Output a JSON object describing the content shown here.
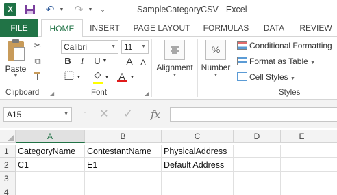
{
  "window": {
    "title": "SampleCategoryCSV - Excel",
    "app_logo_letter": "X"
  },
  "tabs": [
    {
      "label": "FILE"
    },
    {
      "label": "HOME"
    },
    {
      "label": "INSERT"
    },
    {
      "label": "PAGE LAYOUT"
    },
    {
      "label": "FORMULAS"
    },
    {
      "label": "DATA"
    },
    {
      "label": "REVIEW"
    }
  ],
  "active_tab": "HOME",
  "colors": {
    "excel_green": "#217346",
    "font_color_bar": "#e01b1b",
    "highlight_bar": "#ffff00"
  },
  "ribbon": {
    "clipboard": {
      "paste_label": "Paste",
      "group_label": "Clipboard"
    },
    "font": {
      "font_name": "Calibri",
      "font_size": "11",
      "bold": "B",
      "italic": "I",
      "underline": "U",
      "grow": "A",
      "shrink": "A",
      "font_color": "A",
      "group_label": "Font"
    },
    "alignment": {
      "label": "Alignment"
    },
    "number": {
      "label": "Number",
      "icon_text": "%"
    },
    "styles": {
      "conditional_formatting": "Conditional Formatting",
      "format_as_table": "Format as Table",
      "cell_styles": "Cell Styles",
      "group_label": "Styles"
    }
  },
  "formula_bar": {
    "name_box": "A15",
    "fx": "fx",
    "formula": ""
  },
  "sheet": {
    "columns": [
      "A",
      "B",
      "C",
      "D",
      "E"
    ],
    "selected_column": "A",
    "rows": [
      {
        "num": "1",
        "cells": [
          "CategoryName",
          "ContestantName",
          "PhysicalAddress",
          "",
          ""
        ]
      },
      {
        "num": "2",
        "cells": [
          "C1",
          "E1",
          "Default Address",
          "",
          ""
        ]
      },
      {
        "num": "3",
        "cells": [
          "",
          "",
          "",
          "",
          ""
        ]
      },
      {
        "num": "4",
        "cells": [
          "",
          "",
          "",
          "",
          ""
        ]
      }
    ]
  }
}
